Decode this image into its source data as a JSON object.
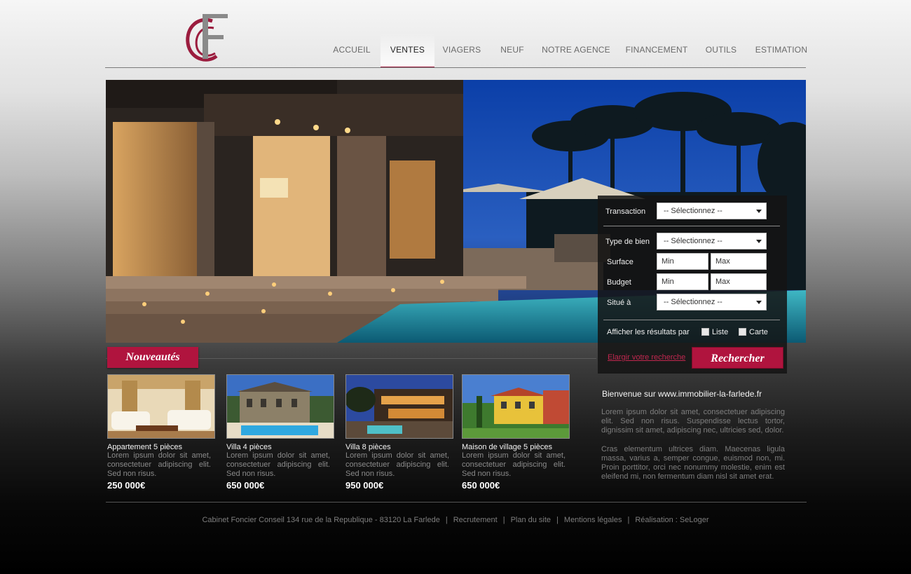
{
  "header": {
    "logo_letters": "CF",
    "nav": [
      {
        "label": "ACCUEIL",
        "active": false
      },
      {
        "label": "VENTES",
        "active": true
      },
      {
        "label": "VIAGERS",
        "active": false
      },
      {
        "label": "NEUF",
        "active": false
      },
      {
        "label": "NOTRE AGENCE",
        "active": false
      },
      {
        "label": "FINANCEMENT",
        "active": false
      },
      {
        "label": "OUTILS",
        "active": false
      },
      {
        "label": "ESTIMATION",
        "active": false
      }
    ]
  },
  "search": {
    "transaction_label": "Transaction",
    "transaction_value": "-- Sélectionnez --",
    "type_label": "Type de bien",
    "type_value": "-- Sélectionnez --",
    "surface_label": "Surface",
    "surface_min": "Min",
    "surface_max": "Max",
    "budget_label": "Budget",
    "budget_min": "Min",
    "budget_max": "Max",
    "situe_label": "Situé à",
    "situe_value": "-- Sélectionnez --",
    "display_label": "Afficher les résultats par",
    "option_liste": "Liste",
    "option_carte": "Carte",
    "widen_link": "Elargir votre recherche",
    "submit_label": "Rechercher"
  },
  "nouveautes": {
    "heading": "Nouveautés",
    "listings": [
      {
        "title": "Appartement 5 pièces",
        "desc": "Lorem ipsum dolor sit amet, consectetuer adipiscing elit. Sed non risus.",
        "price": "250 000€"
      },
      {
        "title": "Villa 4 pièces",
        "desc": "Lorem ipsum dolor sit amet, consectetuer adipiscing elit. Sed non risus.",
        "price": "650 000€"
      },
      {
        "title": "Villa 8 pièces",
        "desc": "Lorem ipsum dolor sit amet, consectetuer adipiscing elit. Sed non risus.",
        "price": "950 000€"
      },
      {
        "title": "Maison de village 5 pièces",
        "desc": "Lorem ipsum dolor sit amet, consectetuer adipiscing elit. Sed non risus.",
        "price": "650 000€"
      }
    ]
  },
  "welcome": {
    "title": "Bienvenue sur www.immobilier-la-farlede.fr",
    "p1": "Lorem ipsum dolor sit amet, consectetuer adipiscing elit. Sed non risus. Suspendisse lectus tortor, dignissim sit amet, adipiscing nec, ultricies sed, dolor.",
    "p2": "Cras elementum ultrices diam. Maecenas ligula massa, varius a, semper congue, euismod non, mi. Proin porttitor, orci nec nonummy molestie, enim est eleifend mi, non fermentum diam nisl sit amet erat."
  },
  "footer": {
    "address": "Cabinet Foncier Conseil 134 rue de la Republique - 83120 La Farlede",
    "recrutement": "Recrutement",
    "plan": "Plan du site",
    "mentions": "Mentions légales",
    "realisation": "Réalisation : SeLoger"
  },
  "colors": {
    "accent": "#b0143e",
    "nav_text": "#6a6a6a",
    "panel_bg": "#141414"
  }
}
